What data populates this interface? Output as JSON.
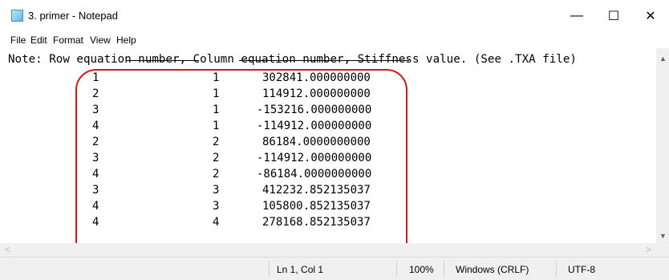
{
  "window": {
    "title": "3. primer - Notepad",
    "minimize_glyph": "—",
    "maximize_glyph": "☐",
    "close_glyph": "✕"
  },
  "menu": [
    "File",
    "Edit",
    "Format",
    "View",
    "Help"
  ],
  "editor": {
    "note_line": "Note: Row equation number, Column equation number, Stiffness value. (See .TXA file)",
    "rows": [
      {
        "row": "1",
        "col": "1",
        "value": "302841.000000000"
      },
      {
        "row": "2",
        "col": "1",
        "value": "114912.000000000"
      },
      {
        "row": "3",
        "col": "1",
        "value": "-153216.000000000"
      },
      {
        "row": "4",
        "col": "1",
        "value": "-114912.000000000"
      },
      {
        "row": "2",
        "col": "2",
        "value": "86184.0000000000"
      },
      {
        "row": "3",
        "col": "2",
        "value": "-114912.000000000"
      },
      {
        "row": "4",
        "col": "2",
        "value": "-86184.0000000000"
      },
      {
        "row": "3",
        "col": "3",
        "value": "412232.852135037"
      },
      {
        "row": "4",
        "col": "3",
        "value": "105800.852135037"
      },
      {
        "row": "4",
        "col": "4",
        "value": "278168.852135037"
      }
    ]
  },
  "status": {
    "position": "Ln 1, Col 1",
    "zoom": "100%",
    "line_ending": "Windows (CRLF)",
    "encoding": "UTF-8"
  },
  "colors": {
    "annotation": "#d11818"
  }
}
